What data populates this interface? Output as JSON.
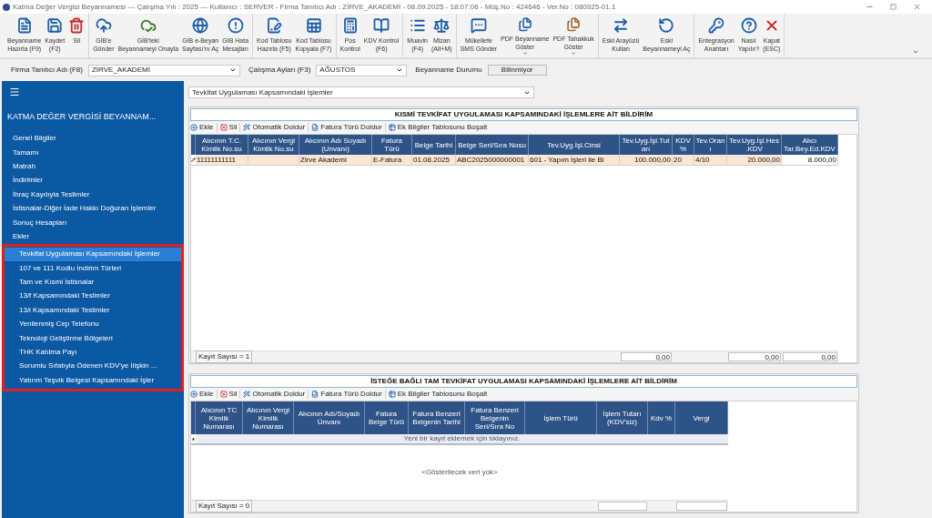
{
  "window": {
    "title": "Katma Değer Vergisi Beyannamesi  ---  Çalışma Yılı : 2025  ---  Kullanıcı : SERVER - Firma Tanıtıcı Adı : ZİRVE_AKADEMİ - 08.09.2025 - 18:07:06 - Müş.No : 424646 - Ver.No : 080925-01.1"
  },
  "toolbar": {
    "groups": [
      [
        {
          "label": "Beyanname\nHazırla (F9)",
          "has_menu": false
        },
        {
          "label": "Kaydet\n(F2)",
          "has_menu": false
        },
        {
          "label": "Sil",
          "has_menu": false
        }
      ],
      [
        {
          "label": "GİB'e\nGönder",
          "has_menu": false
        },
        {
          "label": "GİB'teki\nBeyannameyi Onayla",
          "has_menu": false
        },
        {
          "label": "GİB e-Beyan\nSayfası'nı Aç",
          "has_menu": false
        },
        {
          "label": "GİB Hata\nMesajları",
          "has_menu": false
        }
      ],
      [
        {
          "label": "Kod Tablosu\nHazırla (F5)",
          "has_menu": false
        },
        {
          "label": "Kod Tablosu\nKopyala (F7)",
          "has_menu": false
        }
      ],
      [
        {
          "label": "Pos\nKontrol",
          "has_menu": false
        },
        {
          "label": "KDV Kontrol\n(F6)",
          "has_menu": false
        }
      ],
      [
        {
          "label": "Muavin\n(F4)",
          "has_menu": false
        },
        {
          "label": "Mizan\n(Alt+M)",
          "has_menu": false
        }
      ],
      [
        {
          "label": "Mükellefe\nSMS Gönder",
          "has_menu": false
        },
        {
          "label": "PDF Beyanname\nGöster",
          "has_menu": true
        },
        {
          "label": "PDF Tahakkuk\nGöster",
          "has_menu": true
        }
      ],
      [
        {
          "label": "Eski Arayüzü\nKullan",
          "has_menu": false
        },
        {
          "label": "Eski\nBeyannameyi Aç",
          "has_menu": false
        }
      ],
      [
        {
          "label": "Entegrasyon\nAnahtarı",
          "has_menu": false
        },
        {
          "label": "Nasıl\nYapılır?",
          "has_menu": false
        },
        {
          "label": "Kapat\n(ESC)",
          "has_menu": false
        }
      ]
    ]
  },
  "filters": {
    "company_label": "Firma Tanıtıcı Adı (F8)",
    "company_value": "ZİRVE_AKADEMİ",
    "month_label": "Çalışma Ayları (F3)",
    "month_value": "AĞUSTOS",
    "status_label": "Beyanname Durumu",
    "status_value": "Bilinmiyor"
  },
  "sidebar": {
    "title": "KATMA  DEĞER VERGİSİ BEYANNAM...",
    "items": [
      {
        "label": "Genel Bilgiler",
        "selected": false
      },
      {
        "label": "Tamamı",
        "selected": false
      },
      {
        "label": "Matrah",
        "selected": false
      },
      {
        "label": "İndirimler",
        "selected": false
      },
      {
        "label": "İhraç Kaydıyla Teslimler",
        "selected": false
      },
      {
        "label": "İstisnalar-Diğer İade Hakkı Doğuran İşlemler",
        "selected": false
      },
      {
        "label": "Sonuç Hesapları",
        "selected": false
      },
      {
        "label": "Ekler",
        "selected": false,
        "highlighted": true,
        "children": [
          {
            "label": "Tevkifat Uygulaması Kapsamındaki İşlemler",
            "selected": true
          },
          {
            "label": "107 ve 111 Kodlu İndirim Türleri",
            "selected": false
          },
          {
            "label": "Tam ve Kısmi İstisnalar",
            "selected": false
          },
          {
            "label": "13/f Kapsamındaki Teslimler",
            "selected": false
          },
          {
            "label": "13/i Kapsamındaki Teslimler",
            "selected": false
          },
          {
            "label": "Yenilenmiş Cep Telefonu",
            "selected": false
          },
          {
            "label": "Teknoloji Geliştirme Bölgeleri",
            "selected": false
          },
          {
            "label": "THK Katılma Payı",
            "selected": false
          },
          {
            "label": "Sorumlu Sıfatıyla Ödenen KDV'ye İlişkin ...",
            "selected": false
          },
          {
            "label": "Yatırım Teşvik Belgesi Kapsamındaki İşler",
            "selected": false
          }
        ]
      }
    ]
  },
  "section_select": {
    "value": "Tevkifat Uygulaması Kapsamındaki İşlemler"
  },
  "panels": [
    {
      "title": "KISMİ TEVKİFAT UYGULAMASI KAPSAMINDAKİ İŞLEMLERE AİT BİLDİRİM",
      "actions": [
        "Ekle",
        "Sil",
        "Otomatik Doldur",
        "Fatura Türü Doldur",
        "Ek Bilgiler Tablosunu Boşalt"
      ],
      "columns": [
        {
          "label": "Alıcının T.C. Kimlik No.su",
          "has_total_box": false
        },
        {
          "label": "Alıcının Vergi Kimlik No.su",
          "has_total_box": false
        },
        {
          "label": "Alıcının Adı Soyadı (Unvanı)",
          "has_total_box": false
        },
        {
          "label": "Fatura Türü",
          "has_total_box": false
        },
        {
          "label": "Belge Tarihi",
          "has_total_box": false
        },
        {
          "label": "Belge Seri/Sıra Nosu",
          "has_total_box": false
        },
        {
          "label": "Tev.Uyg.İşl.Cinsi",
          "has_total_box": false
        },
        {
          "label": "Tev.Uyg.İşl.Tutarı",
          "has_total_box": true,
          "total": "0,00"
        },
        {
          "label": "KDV %",
          "has_total_box": false
        },
        {
          "label": "Tev.Oranı",
          "has_total_box": false
        },
        {
          "label": "Tev.Uyg.İşl.Hes.KDV",
          "has_total_box": true,
          "total": "0,00"
        },
        {
          "label": "Alıcı Tar.Bey.Ed.KDV",
          "has_total_box": true,
          "total": "0,00"
        }
      ],
      "rows": [
        {
          "editing": true,
          "cells": [
            {
              "kind": "text",
              "text": "11111111111"
            },
            {
              "kind": "blank"
            },
            {
              "kind": "text",
              "text": "Zirve Akademi"
            },
            {
              "kind": "text",
              "text": "E-Fatura"
            },
            {
              "kind": "text",
              "text": "01.08.2025"
            },
            {
              "kind": "text",
              "text": "ABC2025000000001"
            },
            {
              "kind": "text",
              "text": "601 - Yapım İşleri ile Bi"
            },
            {
              "kind": "text",
              "text": "100.000,00"
            },
            {
              "kind": "text",
              "text": "20"
            },
            {
              "kind": "text",
              "text": "4/10"
            },
            {
              "kind": "text",
              "text": "20.000,00"
            },
            {
              "kind": "text",
              "text": "8.000,00"
            }
          ]
        }
      ],
      "record_count": "Kayıt Sayısı = 1"
    },
    {
      "title": "İSTEĞE BAĞLI TAM TEVKİFAT UYGULAMASI KAPSAMINDAKİ İŞLEMLERE AİT BİLDİRİM",
      "actions": [
        "Ekle",
        "Sil",
        "Otomatik Doldur",
        "Fatura Türü Doldur",
        "Ek Bilgiler Tablosunu Boşalt"
      ],
      "columns": [
        {
          "label": "Alıcının TC Kimlik Numarası",
          "has_total_box": false
        },
        {
          "label": "Alıcının Vergi Kimlik Numarası",
          "has_total_box": false
        },
        {
          "label": "Alıcının Adı/Soyadı Ünvanı",
          "has_total_box": false
        },
        {
          "label": "Fatura Belge Türü",
          "has_total_box": false
        },
        {
          "label": "Fatura Benzeri Belgenin Tarihi",
          "has_total_box": false
        },
        {
          "label": "Fatura Benzeri Belgenin Seri/Sıra No",
          "has_total_box": false
        },
        {
          "label": "İşlem Türü",
          "has_total_box": false
        },
        {
          "label": "İşlem Tutarı (KDV'siz)",
          "has_total_box": true
        },
        {
          "label": "Kdv %",
          "has_total_box": false
        },
        {
          "label": "Vergi",
          "has_total_box": true
        }
      ],
      "new_row_prompt": "Yeni bir kayıt eklemek için tıklayınız.",
      "empty_text": "<Gösterilecek veri yok>",
      "record_count": "Kayıt Sayısı = 0"
    }
  ]
}
